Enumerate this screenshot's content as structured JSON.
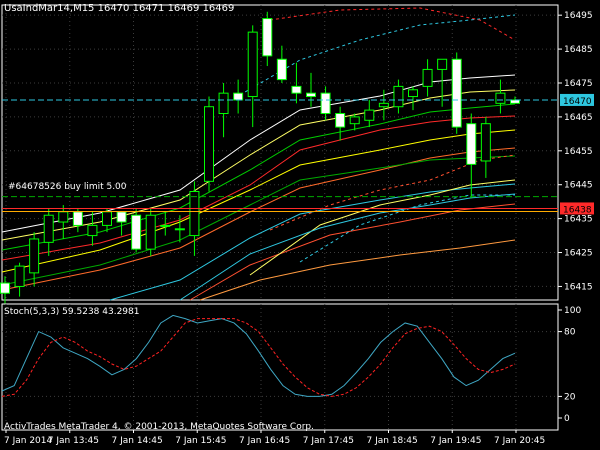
{
  "header": "UsaIndMar14,M15  16470 16471 16469 16469",
  "order_label": "#64678526 buy limit 5.00",
  "footer": "ActivTrades MetaTrader 4, © 2001-2013, MetaQuotes Software Corp.",
  "stoch_label": "Stoch(5,3,3) 59.5238 43.2981",
  "price_box": {
    "current": "16470",
    "red": "16438"
  },
  "colors": {
    "bg": "#000000",
    "grid": "#3c3c3c",
    "bull": "#00ff00",
    "bear": "#ffffff",
    "axis": "#ffffff",
    "current": "#2ec7e0",
    "order": "#00aa00",
    "red_line": "#ff2a2a"
  },
  "chart_data": [
    {
      "type": "candlestick",
      "symbol": "UsaIndMar14",
      "timeframe": "M15",
      "y_ticks": [
        "16495",
        "16485",
        "16475",
        "16465",
        "16455",
        "16445",
        "16435",
        "16425",
        "16415"
      ],
      "ylim": [
        16411,
        16498
      ],
      "x_ticks": [
        "7 Jan 2014",
        "7 Jan 13:45",
        "7 Jan 14:45",
        "7 Jan 15:45",
        "7 Jan 16:45",
        "7 Jan 17:45",
        "7 Jan 18:45",
        "7 Jan 19:45",
        "7 Jan 20:45"
      ],
      "current_price": 16470,
      "order_price": 16441.5,
      "red_level": 16438,
      "candles": [
        {
          "o": 16416,
          "h": 16418,
          "l": 16410,
          "c": 16413
        },
        {
          "o": 16415,
          "h": 16422,
          "l": 16412,
          "c": 16421
        },
        {
          "o": 16419,
          "h": 16431,
          "l": 16415,
          "c": 16429
        },
        {
          "o": 16428,
          "h": 16438,
          "l": 16424,
          "c": 16436
        },
        {
          "o": 16434,
          "h": 16439,
          "l": 16429,
          "c": 16437
        },
        {
          "o": 16437,
          "h": 16438,
          "l": 16431,
          "c": 16433
        },
        {
          "o": 16430,
          "h": 16437,
          "l": 16427,
          "c": 16433
        },
        {
          "o": 16433,
          "h": 16438,
          "l": 16431,
          "c": 16437
        },
        {
          "o": 16437,
          "h": 16436,
          "l": 16430,
          "c": 16434
        },
        {
          "o": 16436,
          "h": 16438,
          "l": 16425,
          "c": 16426
        },
        {
          "o": 16426,
          "h": 16438,
          "l": 16424,
          "c": 16436
        },
        {
          "o": 16433,
          "h": 16437,
          "l": 16430,
          "c": 16433
        },
        {
          "o": 16432,
          "h": 16436,
          "l": 16428,
          "c": 16432
        },
        {
          "o": 16430,
          "h": 16446,
          "l": 16424,
          "c": 16443
        },
        {
          "o": 16446,
          "h": 16471,
          "l": 16443,
          "c": 16468
        },
        {
          "o": 16466,
          "h": 16475,
          "l": 16459,
          "c": 16472
        },
        {
          "o": 16472,
          "h": 16476,
          "l": 16466,
          "c": 16470
        },
        {
          "o": 16471,
          "h": 16492,
          "l": 16462,
          "c": 16490
        },
        {
          "o": 16494,
          "h": 16496,
          "l": 16480,
          "c": 16483
        },
        {
          "o": 16482,
          "h": 16486,
          "l": 16475,
          "c": 16476
        },
        {
          "o": 16474,
          "h": 16481,
          "l": 16469,
          "c": 16472
        },
        {
          "o": 16472,
          "h": 16478,
          "l": 16468,
          "c": 16471
        },
        {
          "o": 16472,
          "h": 16474,
          "l": 16464,
          "c": 16466
        },
        {
          "o": 16466,
          "h": 16468,
          "l": 16458,
          "c": 16462
        },
        {
          "o": 16463,
          "h": 16466,
          "l": 16461,
          "c": 16465
        },
        {
          "o": 16464,
          "h": 16470,
          "l": 16462,
          "c": 16467
        },
        {
          "o": 16468,
          "h": 16473,
          "l": 16464,
          "c": 16469
        },
        {
          "o": 16468,
          "h": 16476,
          "l": 16466,
          "c": 16474
        },
        {
          "o": 16471,
          "h": 16474,
          "l": 16467,
          "c": 16473
        },
        {
          "o": 16474,
          "h": 16482,
          "l": 16471,
          "c": 16479
        },
        {
          "o": 16479,
          "h": 16482,
          "l": 16468,
          "c": 16482
        },
        {
          "o": 16482,
          "h": 16484,
          "l": 16460,
          "c": 16462
        },
        {
          "o": 16463,
          "h": 16466,
          "l": 16441,
          "c": 16451
        },
        {
          "o": 16452,
          "h": 16465,
          "l": 16447,
          "c": 16463
        },
        {
          "o": 16469,
          "h": 16476,
          "l": 16466,
          "c": 16472
        },
        {
          "o": 16470,
          "h": 16471,
          "l": 16469,
          "c": 16469
        }
      ]
    },
    {
      "type": "line",
      "name": "Stoch(5,3,3)",
      "ylim": [
        0,
        100
      ],
      "y_ticks": [
        "100",
        "80",
        "20",
        "0"
      ],
      "series": [
        {
          "name": "main",
          "color": "#3fa7c4",
          "values": [
            25,
            30,
            55,
            80,
            75,
            65,
            60,
            55,
            48,
            40,
            45,
            55,
            70,
            88,
            95,
            92,
            88,
            90,
            92,
            88,
            78,
            62,
            45,
            30,
            22,
            20,
            20,
            22,
            30,
            42,
            55,
            70,
            80,
            88,
            85,
            70,
            55,
            38,
            30,
            35,
            45,
            55,
            60
          ]
        },
        {
          "name": "signal",
          "color": "#ff2222",
          "values": [
            20,
            22,
            35,
            55,
            70,
            75,
            70,
            62,
            57,
            50,
            45,
            48,
            55,
            62,
            75,
            88,
            92,
            92,
            92,
            92,
            88,
            80,
            65,
            50,
            38,
            28,
            22,
            20,
            22,
            28,
            38,
            50,
            65,
            78,
            83,
            85,
            80,
            68,
            55,
            45,
            42,
            45,
            50
          ]
        }
      ]
    }
  ]
}
